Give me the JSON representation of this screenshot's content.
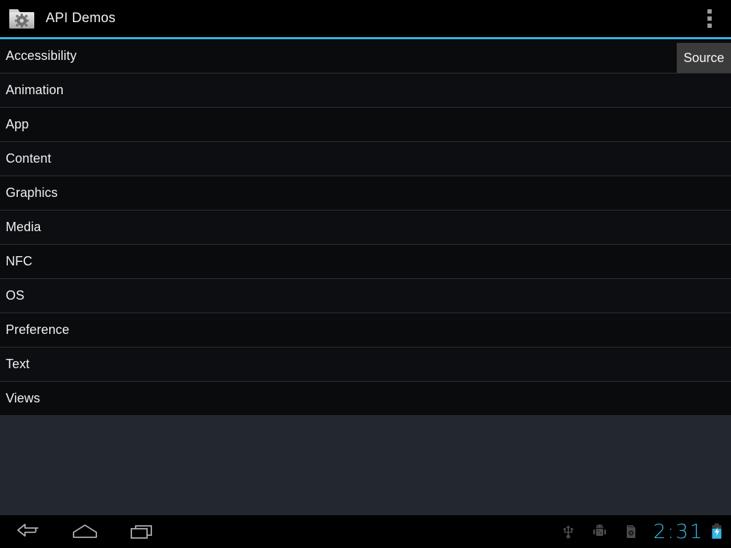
{
  "app": {
    "title": "API Demos",
    "icon": "folder-gear-icon"
  },
  "action_bar": {
    "overflow_menu_label": "More options",
    "overflow_icon": "overflow-menu-icon",
    "accent_color": "#33b5e5"
  },
  "source_button": {
    "label": "Source",
    "background": "#3b3b3b"
  },
  "list": {
    "items": [
      {
        "label": "Accessibility"
      },
      {
        "label": "Animation"
      },
      {
        "label": "App"
      },
      {
        "label": "Content"
      },
      {
        "label": "Graphics"
      },
      {
        "label": "Media"
      },
      {
        "label": "NFC"
      },
      {
        "label": "OS"
      },
      {
        "label": "Preference"
      },
      {
        "label": "Text"
      },
      {
        "label": "Views"
      }
    ]
  },
  "navigation_bar": {
    "back_icon": "back-arrow-icon",
    "home_icon": "home-icon",
    "recents_icon": "recent-apps-icon",
    "status": {
      "usb_icon": "usb-icon",
      "adb_icon": "android-debug-icon",
      "sdcard_icon": "sd-card-icon",
      "clock": "2:31",
      "clock_color": "#33b5e5",
      "battery_icon": "battery-charging-icon",
      "battery_color": "#33b5e5"
    }
  }
}
